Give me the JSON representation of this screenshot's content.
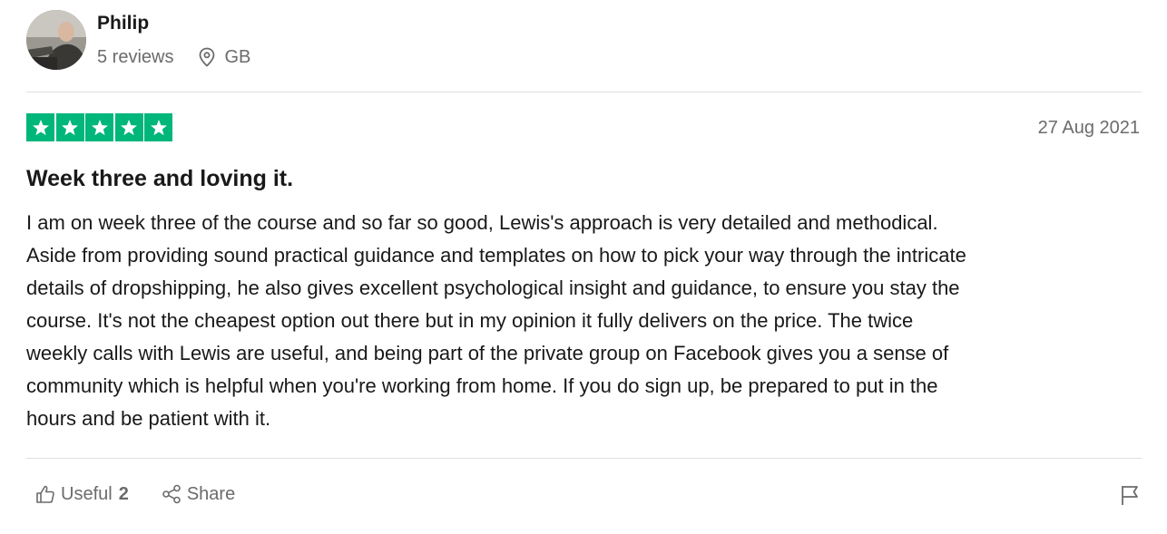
{
  "reviewer": {
    "name": "Philip",
    "reviews": "5 reviews",
    "country": "GB",
    "avatar_icon": "avatar-photo"
  },
  "review": {
    "rating": 5,
    "rating_max": 5,
    "star_color": "#00b67a",
    "date": "27 Aug 2021",
    "title": "Week three and loving it.",
    "body": "I am on week three of the course and so far so good, Lewis's approach is very detailed and methodical.\nAside from providing sound practical guidance and templates on how to pick your way through the intricate\ndetails of dropshipping, he also gives excellent psychological insight and guidance, to ensure you stay the\ncourse. It's not the cheapest option out there but in my opinion it fully delivers on the price. The twice\nweekly calls with Lewis are useful, and being part of the private group on Facebook gives you a sense of\ncommunity which is helpful when you're working from home. If you do sign up, be prepared to put in the\nhours and be patient with it."
  },
  "actions": {
    "useful_label": "Useful",
    "useful_count": "2",
    "share_label": "Share",
    "useful_icon": "thumbs-up-icon",
    "share_icon": "share-icon",
    "report_icon": "flag-icon"
  }
}
